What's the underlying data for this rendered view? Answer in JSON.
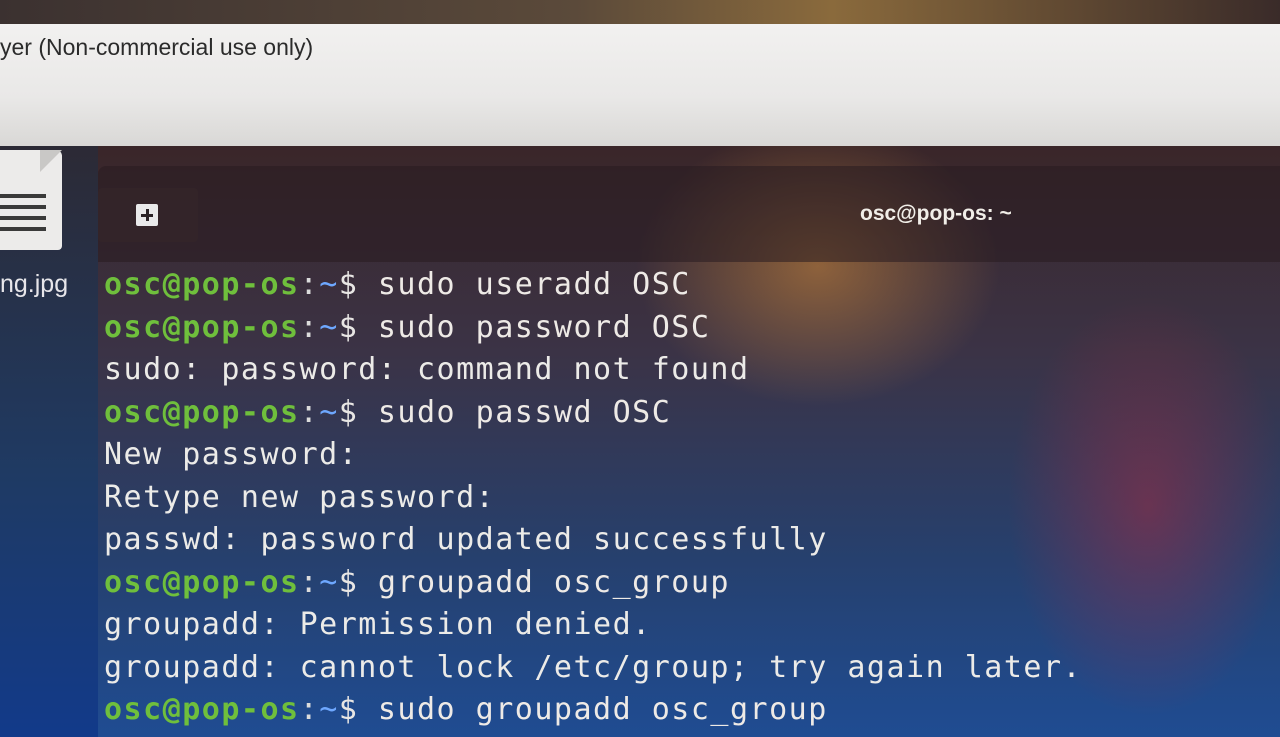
{
  "background_window": {
    "title": "yer (Non-commercial use only)"
  },
  "desktop": {
    "file_name": "ng.jpg"
  },
  "terminal": {
    "window_title": "osc@pop-os: ~",
    "prompt": {
      "user_host": "osc@pop-os",
      "colon": ":",
      "path": "~",
      "dollar": "$ "
    },
    "lines": [
      {
        "type": "prompt",
        "command": "sudo useradd OSC"
      },
      {
        "type": "prompt",
        "command": "sudo password OSC"
      },
      {
        "type": "output",
        "text": "sudo: password: command not found"
      },
      {
        "type": "prompt",
        "command": "sudo passwd OSC"
      },
      {
        "type": "output",
        "text": "New password:"
      },
      {
        "type": "output",
        "text": "Retype new password:"
      },
      {
        "type": "output",
        "text": "passwd: password updated successfully"
      },
      {
        "type": "prompt",
        "command": "groupadd osc_group"
      },
      {
        "type": "output",
        "text": "groupadd: Permission denied."
      },
      {
        "type": "output",
        "text": "groupadd: cannot lock /etc/group; try again later."
      },
      {
        "type": "prompt",
        "command": "sudo groupadd osc_group"
      }
    ]
  },
  "colors": {
    "prompt_user": "#6fbf3c",
    "prompt_path": "#6ea8ff",
    "text": "#e8e6e4"
  },
  "icons": {
    "new_tab": "new-tab-icon",
    "file": "document-file-icon"
  }
}
